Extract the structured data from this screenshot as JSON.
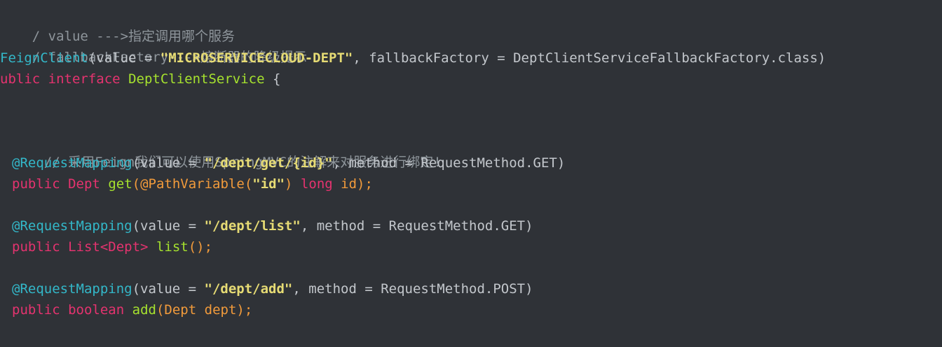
{
  "code": {
    "line1": {
      "comment": "/ value --->指定调用哪个服务"
    },
    "line2": {
      "comment": "/ fallbackFactory--->熔断器的降级提示"
    },
    "line3": {
      "annotation": "FeignClient",
      "open": "(value = ",
      "value_string": "\"MICROSERVICECLOUD-DEPT\"",
      "rest": ", fallbackFactory = DeptClientServiceFallbackFactory.class)"
    },
    "line4": {
      "modifier": "ublic",
      "keyword": "interface",
      "name": "DeptClientService",
      "brace": " {"
    },
    "line5": {
      "comment": "// 采用Feign我们可以使用SpringMVC的注解来对服务进行绑定!"
    },
    "mapping1": {
      "annotation": "@RequestMapping",
      "open": "(value = ",
      "path": "\"/dept/get/{id}\"",
      "rest": ", method = RequestMethod.GET)"
    },
    "method1": {
      "modifier": "public",
      "type": "Dept",
      "name": "get",
      "open": "(",
      "param_annotation": "@PathVariable",
      "pa_open": "(",
      "param_string": "\"id\"",
      "pa_close": ")",
      "param_type": "long",
      "param_name": "id",
      "close": ");"
    },
    "mapping2": {
      "annotation": "@RequestMapping",
      "open": "(value = ",
      "path": "\"/dept/list\"",
      "rest": ", method = RequestMethod.GET)"
    },
    "method2": {
      "modifier": "public",
      "type": "List<Dept>",
      "name": "list",
      "open": "(",
      "close": ");"
    },
    "mapping3": {
      "annotation": "@RequestMapping",
      "open": "(value = ",
      "path": "\"/dept/add\"",
      "rest": ", method = RequestMethod.POST)"
    },
    "method3": {
      "modifier": "public",
      "type": "boolean",
      "name": "add",
      "open": "(",
      "param_type": "Dept",
      "param_name": "dept",
      "close": ");"
    }
  },
  "colors": {
    "background": "#2f3237",
    "comment": "#8e959b",
    "keyword": "#e5336f",
    "annotation": "#33b8c9",
    "string": "#e6db74",
    "function": "#a6e22e",
    "parameter": "#f29b3b",
    "plain": "#c3c7cc"
  }
}
